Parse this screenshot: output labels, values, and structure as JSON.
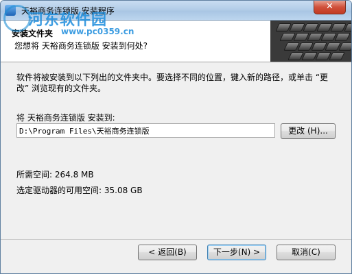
{
  "window": {
    "title": "天裕商务连锁版 安装程序",
    "close_label": "✕"
  },
  "watermark": {
    "text": "河东软件园",
    "url": "www.pc0359.cn"
  },
  "header": {
    "title": "安装文件夹",
    "subtitle": "您想将 天裕商务连锁版 安装到何处?"
  },
  "main": {
    "description": "软件将被安装到以下列出的文件夹中。要选择不同的位置，键入新的路径，或单击 “更改” 浏览现有的文件夹。",
    "dest_label": "将 天裕商务连锁版 安装到:",
    "dest_path": "D:\\Program Files\\天裕商务连锁版",
    "browse_label": "更改 (H)...",
    "space_required": "所需空间: 264.8 MB",
    "space_available": "选定驱动器的可用空间: 35.08 GB"
  },
  "footer": {
    "back_label": "< 返回(B)",
    "next_label": "下一步(N) >",
    "cancel_label": "取消(C)"
  }
}
